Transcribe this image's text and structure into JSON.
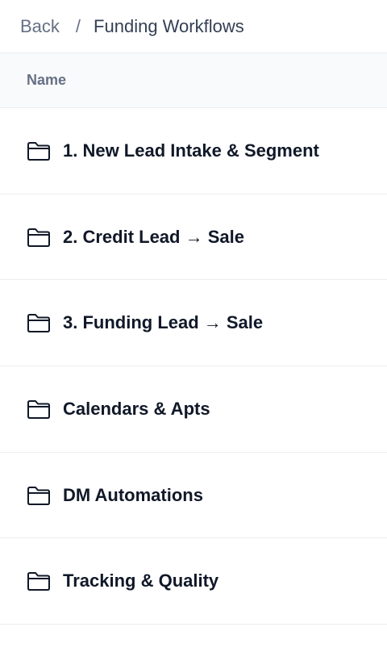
{
  "breadcrumb": {
    "back_label": "Back",
    "separator": "/",
    "current": "Funding Workflows"
  },
  "table": {
    "header_name": "Name",
    "rows": [
      {
        "label": "1. New Lead Intake & Segment",
        "icon": "folder-icon"
      },
      {
        "label": "2. Credit Lead → Sale",
        "icon": "folder-icon"
      },
      {
        "label": "3. Funding Lead → Sale",
        "icon": "folder-icon"
      },
      {
        "label": "Calendars & Apts",
        "icon": "folder-icon"
      },
      {
        "label": "DM Automations",
        "icon": "folder-icon"
      },
      {
        "label": "Tracking & Quality",
        "icon": "folder-icon"
      }
    ]
  }
}
